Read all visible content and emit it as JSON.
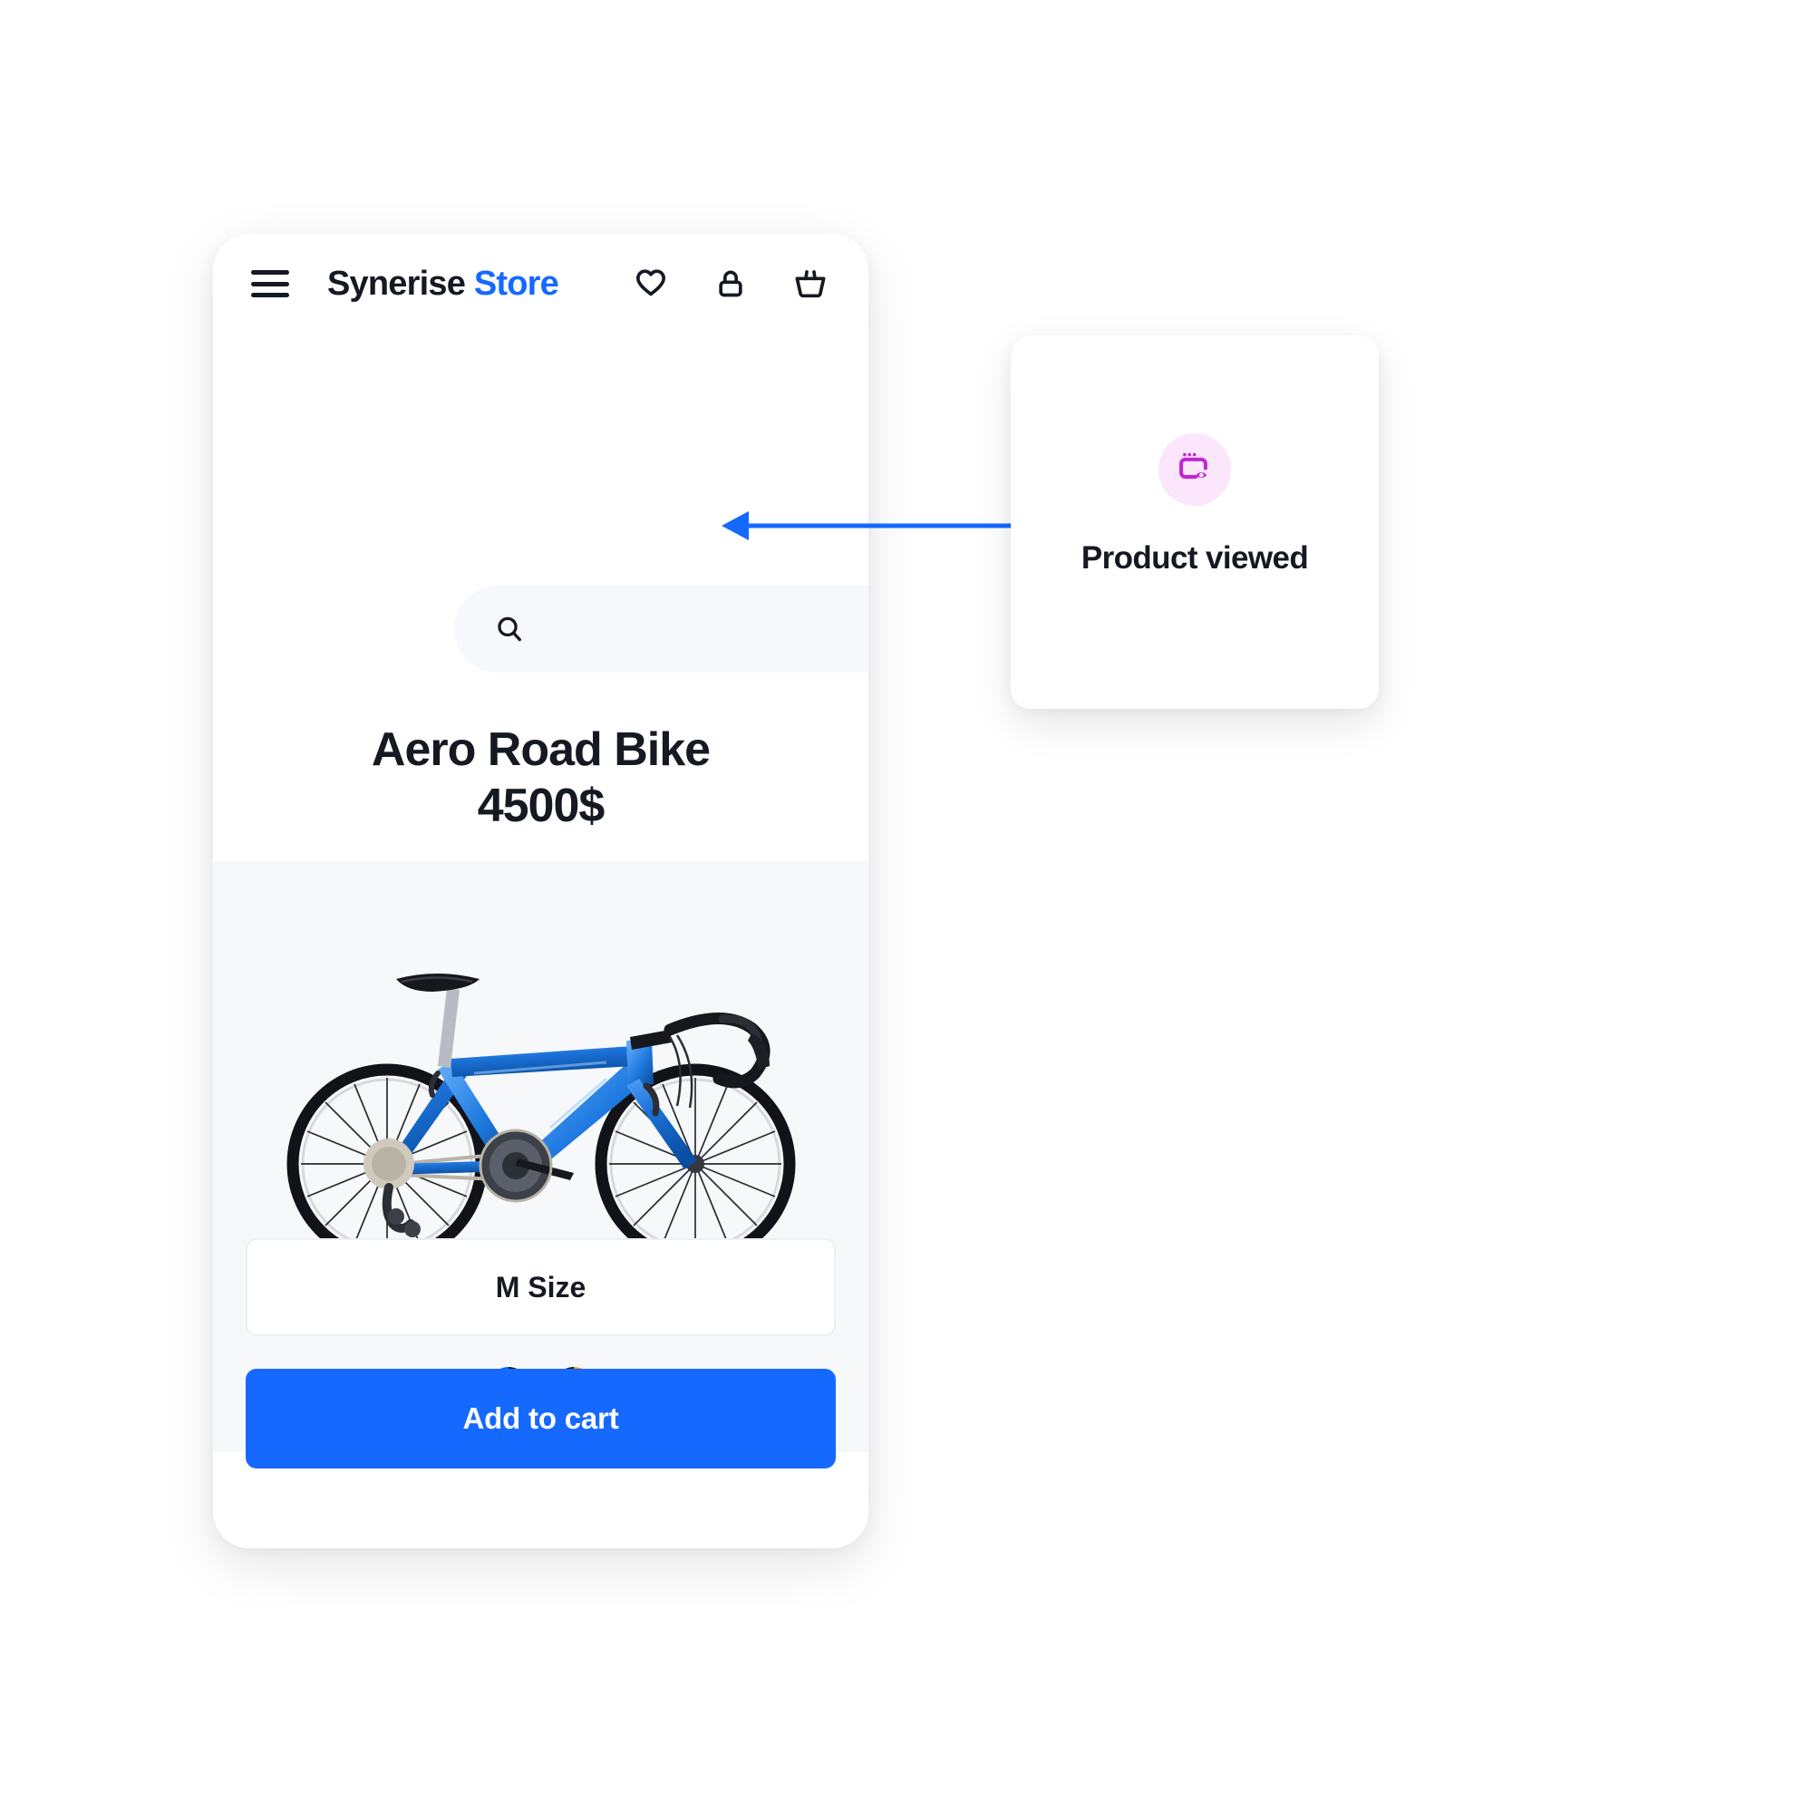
{
  "colors": {
    "accent_blue": "#1569FF",
    "text_dark": "#151922",
    "image_band_bg": "#f6f8fa",
    "search_bg": "#f6f8fb",
    "annotation_icon": "#C026D3",
    "annotation_icon_bg": "#fbe6fb",
    "swatch_blue": "#0B6BDE",
    "swatch_navy": "#171B26",
    "swatch_orange": "#FF8A00"
  },
  "phone": {
    "header": {
      "menu_icon": "hamburger-menu-icon",
      "brand_primary": "Synerise",
      "brand_accent": "Store",
      "icons": [
        {
          "name": "wishlist-heart-icon",
          "label": "Wishlist"
        },
        {
          "name": "account-lock-icon",
          "label": "Account"
        },
        {
          "name": "cart-basket-icon",
          "label": "Cart"
        }
      ]
    },
    "search": {
      "icon": "search-icon",
      "value": "",
      "placeholder": ""
    },
    "product": {
      "name": "Aero Road Bike",
      "price": "4500$",
      "image_alt": "Blue aero road bike side view",
      "swatches": [
        {
          "name": "color-swatch-blue-navy",
          "left": "#0B6BDE",
          "right": "#171B26"
        },
        {
          "name": "color-swatch-navy-orange",
          "left": "#171B26",
          "right": "#FF8A00"
        }
      ],
      "size_label": "M Size",
      "add_to_cart_label": "Add to cart"
    }
  },
  "annotation": {
    "icon": "product-viewed-icon",
    "label": "Product viewed",
    "arrow_direction": "left"
  }
}
